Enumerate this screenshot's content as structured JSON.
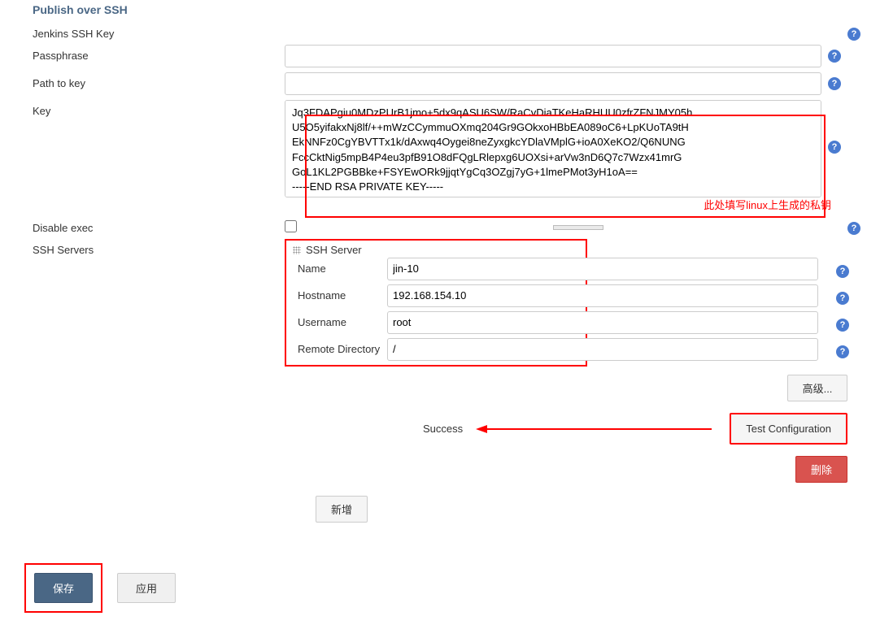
{
  "section_title": "Publish over SSH",
  "labels": {
    "jenkins_ssh_key": "Jenkins SSH Key",
    "passphrase": "Passphrase",
    "path_to_key": "Path to key",
    "key": "Key",
    "disable_exec": "Disable exec",
    "ssh_servers": "SSH Servers",
    "ssh_server": "SSH Server",
    "name": "Name",
    "hostname": "Hostname",
    "username": "Username",
    "remote_directory": "Remote Directory"
  },
  "values": {
    "passphrase": "",
    "path_to_key": "",
    "key": "Jq3FDAPgiu0MDzPUrB1jmo+5dx9qASU6SW/RaCvDiaTKeHaRHUU0zfrZFNJMY05h\nU5O5yifakxNj8lf/++mWzCCymmuOXmq204Gr9GOkxoHBbEA089oC6+LpKUoTA9tH\nEkNNFz0CgYBVTTx1k/dAxwq4Oygei8neZyxgkcYDlaVMplG+ioA0XeKO2/Q6NUNG\nFccCktNig5mpB4P4eu3pfB91O8dFQgLRlepxg6UOXsi+arVw3nD6Q7c7Wzx41mrG\nGoL1KL2PGBBke+FSYEwORk9jjqtYgCq3OZgj7yG+1lmePMot3yH1oA==\n-----END RSA PRIVATE KEY-----",
    "name": "jin-10",
    "hostname": "192.168.154.10",
    "username": "root",
    "remote_directory": "/"
  },
  "annotations": {
    "key_note": "此处填写linux上生成的私钥"
  },
  "buttons": {
    "advanced": "高级...",
    "test_configuration": "Test Configuration",
    "delete": "删除",
    "add": "新增",
    "save": "保存",
    "apply": "应用"
  },
  "status": {
    "success": "Success"
  }
}
